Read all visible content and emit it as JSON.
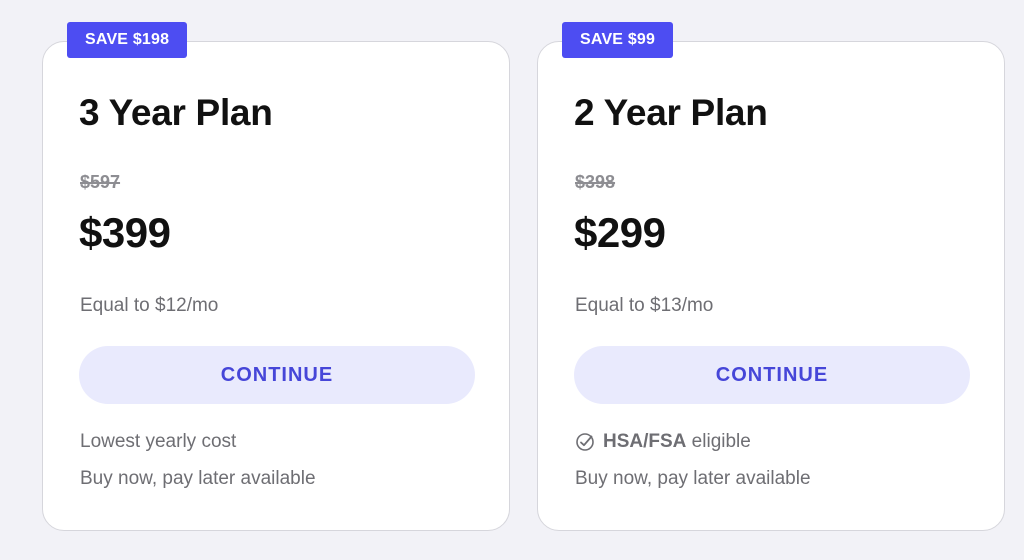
{
  "plans": [
    {
      "badge": "SAVE $198",
      "title": "3 Year Plan",
      "old_price": "$597",
      "price": "$399",
      "monthly": "Equal to $12/mo",
      "button_label": "CONTINUE",
      "feature_1": "Lowest yearly cost",
      "feature_2": "Buy now, pay later available"
    },
    {
      "badge": "SAVE $99",
      "title": "2 Year Plan",
      "old_price": "$398",
      "price": "$299",
      "monthly": "Equal to $13/mo",
      "button_label": "CONTINUE",
      "feature_1_icon": "circle-check-icon",
      "feature_1_bold": "HSA/FSA",
      "feature_1_rest": " eligible",
      "feature_2": "Buy now, pay later available"
    }
  ],
  "colors": {
    "accent": "#4d4df2",
    "button_bg": "#e9eafd",
    "button_text": "#4646d8",
    "muted_text": "#6e6e73",
    "strike_text": "#8d8d92",
    "page_bg": "#f2f2f7"
  }
}
